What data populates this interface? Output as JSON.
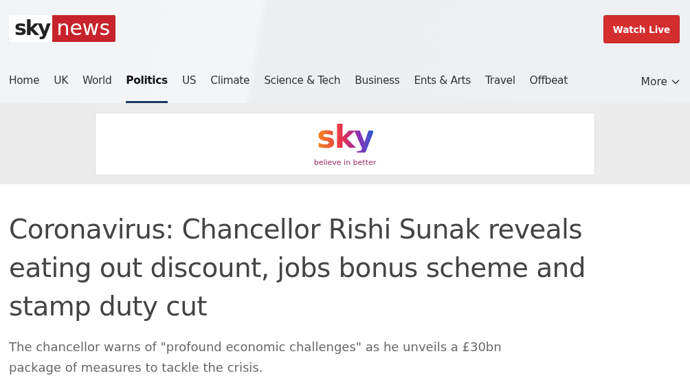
{
  "header": {
    "logo": {
      "part_1": "sky",
      "part_2": "news"
    },
    "watch_button": "Watch Live"
  },
  "nav": {
    "items": [
      {
        "label": "Home",
        "selected": false
      },
      {
        "label": "UK",
        "selected": false
      },
      {
        "label": "World",
        "selected": false
      },
      {
        "label": "Politics",
        "selected": true
      },
      {
        "label": "US",
        "selected": false
      },
      {
        "label": "Climate",
        "selected": false
      },
      {
        "label": "Science & Tech",
        "selected": false
      },
      {
        "label": "Business",
        "selected": false
      },
      {
        "label": "Ents & Arts",
        "selected": false
      },
      {
        "label": "Travel",
        "selected": false
      },
      {
        "label": "Offbeat",
        "selected": false
      }
    ],
    "more": "More"
  },
  "advert": {
    "logo": "sky",
    "tagline": "believe in better"
  },
  "article": {
    "headline": "Coronavirus: Chancellor Rishi Sunak reveals eating out discount, jobs bonus scheme and stamp duty cut",
    "standfirst": "The chancellor warns of \"profound economic challenges\" as he unveils a £30bn package of measures to tackle the crisis."
  }
}
